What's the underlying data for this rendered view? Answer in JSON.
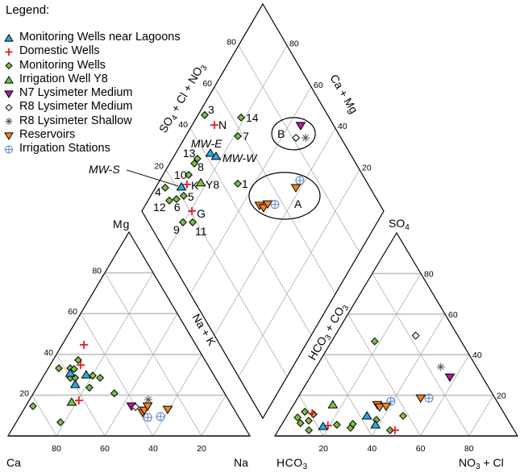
{
  "chart_data": {
    "type": "scatter",
    "subtype": "piper-trilinear",
    "legend_title": "Legend:",
    "legend_placement": "top-left",
    "series_styles": {
      "mwl": {
        "name": "Monitoring Wells near Lagoons",
        "marker": "triangle-up",
        "fill": "#29abe2",
        "stroke": "#000000"
      },
      "dom": {
        "name": "Domestic Wells",
        "marker": "plus",
        "fill": "none",
        "stroke": "#e8131b"
      },
      "mw": {
        "name": "Monitoring Wells",
        "marker": "diamond",
        "fill": "#7ac143",
        "stroke": "#000000"
      },
      "y8": {
        "name": "Irrigation Well Y8",
        "marker": "triangle-up",
        "fill": "#7ac143",
        "stroke": "#000000"
      },
      "n7": {
        "name": "N7 Lysimeter Medium",
        "marker": "triangle-down",
        "fill": "#b5179e",
        "stroke": "#000000"
      },
      "r8m": {
        "name": "R8 Lysimeter Medium",
        "marker": "diamond",
        "fill": "#ffffff",
        "stroke": "#000000"
      },
      "r8s": {
        "name": "R8 Lysimeter Shallow",
        "marker": "asterisk",
        "fill": "none",
        "stroke": "#555555"
      },
      "res": {
        "name": "Reservoirs",
        "marker": "triangle-down",
        "fill": "#f7821b",
        "stroke": "#000000"
      },
      "irr": {
        "name": "Irrigation Stations",
        "marker": "circle-plus",
        "fill": "none",
        "stroke": "#5b7fc7"
      }
    },
    "legend_order": [
      "mwl",
      "dom",
      "mw",
      "y8",
      "n7",
      "r8m",
      "r8s",
      "res",
      "irr"
    ],
    "cation_triangle": {
      "vertices": {
        "left": "Ca",
        "right": "Na",
        "top": "Mg"
      },
      "edge_label": "Na + K",
      "base_ticks": [
        "80",
        "60",
        "40",
        "20"
      ],
      "side_ticks": [
        "20",
        "40",
        "60",
        "80"
      ],
      "points": [
        {
          "series": "dom",
          "mg": 44.7,
          "na": 9.0
        },
        {
          "series": "dom",
          "mg": 34.8,
          "na": 12.6
        },
        {
          "series": "dom",
          "mg": 17.4,
          "na": 20.6
        },
        {
          "series": "mw",
          "mg": 37.2,
          "na": 10.4
        },
        {
          "series": "mw",
          "mg": 33.2,
          "na": 4.4
        },
        {
          "series": "mw",
          "mg": 33.2,
          "na": 9.1
        },
        {
          "series": "mw",
          "mg": 32.8,
          "na": 10.9
        },
        {
          "series": "mw",
          "mg": 28.5,
          "na": 11.5
        },
        {
          "series": "mw",
          "mg": 28.5,
          "na": 13.5
        },
        {
          "series": "mw",
          "mg": 29.6,
          "na": 20.2
        },
        {
          "series": "mw",
          "mg": 28.5,
          "na": 23.8
        },
        {
          "series": "mw",
          "mg": 23.7,
          "na": 21.8
        },
        {
          "series": "mw",
          "mg": 20.9,
          "na": 33.5
        },
        {
          "series": "mw",
          "mg": 14.6,
          "na": 3.0
        },
        {
          "series": "mw",
          "mg": 6.7,
          "na": 18.3
        },
        {
          "series": "mwl",
          "mg": 30.8,
          "na": 10.3
        },
        {
          "series": "mwl",
          "mg": 30.0,
          "na": 17.3
        },
        {
          "series": "mwl",
          "mg": 25.3,
          "na": 15.1
        },
        {
          "series": "y8",
          "mg": 16.6,
          "na": 18.0
        },
        {
          "series": "n7",
          "mg": 14.6,
          "na": 43.7
        },
        {
          "series": "r8m",
          "mg": 14.2,
          "na": 45.6
        },
        {
          "series": "r8s",
          "mg": 17.8,
          "na": 49.1
        },
        {
          "series": "res",
          "mg": 11.5,
          "na": 50.0
        },
        {
          "series": "res",
          "mg": 12.6,
          "na": 50.0
        },
        {
          "series": "res",
          "mg": 14.6,
          "na": 50.4
        },
        {
          "series": "res",
          "mg": 13.0,
          "na": 59.5
        },
        {
          "series": "irr",
          "mg": 9.1,
          "na": 53.2
        },
        {
          "series": "irr",
          "mg": 9.5,
          "na": 58.3
        }
      ]
    },
    "anion_triangle": {
      "vertices": {
        "left": "HCO3",
        "right": "NO3 + Cl",
        "top": "SO4"
      },
      "edge_label": "HCO3 + CO3",
      "base_ticks": [
        "20",
        "40",
        "60",
        "80"
      ],
      "side_ticks": [
        "20",
        "40",
        "60",
        "80"
      ],
      "points": [
        {
          "series": "mw",
          "so4": 46.6,
          "cl": 17.9
        },
        {
          "series": "mw",
          "so4": 9.1,
          "cl": 4.8
        },
        {
          "series": "mw",
          "so4": 6.3,
          "cl": 7.4
        },
        {
          "series": "mw",
          "so4": 11.9,
          "cl": 6.4
        },
        {
          "series": "mw",
          "so4": 7.5,
          "cl": 10.2
        },
        {
          "series": "mw",
          "so4": 2.8,
          "cl": 12.6
        },
        {
          "series": "mw",
          "so4": 10.7,
          "cl": 10.6
        },
        {
          "series": "mw",
          "so4": 5.5,
          "cl": 22.8
        },
        {
          "series": "mw",
          "so4": 4.0,
          "cl": 29.2
        },
        {
          "series": "mw",
          "so4": 5.9,
          "cl": 29.2
        },
        {
          "series": "mw",
          "so4": 7.9,
          "cl": 37.9
        },
        {
          "series": "mw",
          "so4": 2.8,
          "cl": 46.1
        },
        {
          "series": "mw",
          "so4": 9.9,
          "cl": 47.9
        },
        {
          "series": "dom",
          "so4": 11.1,
          "cl": 9.8
        },
        {
          "series": "dom",
          "so4": 5.1,
          "cl": 19.3
        },
        {
          "series": "dom",
          "so4": 2.8,
          "cl": 48.1
        },
        {
          "series": "mwl",
          "so4": 4.7,
          "cl": 17.5
        },
        {
          "series": "mwl",
          "so4": 9.9,
          "cl": 33.0
        },
        {
          "series": "mwl",
          "so4": 5.5,
          "cl": 38.7
        },
        {
          "series": "y8",
          "so4": 15.4,
          "cl": 16.2
        },
        {
          "series": "res",
          "so4": 15.4,
          "cl": 34.5
        },
        {
          "series": "res",
          "so4": 14.2,
          "cl": 36.1
        },
        {
          "series": "res",
          "so4": 14.6,
          "cl": 38.5
        },
        {
          "series": "res",
          "so4": 18.6,
          "cl": 50.8
        },
        {
          "series": "irr",
          "so4": 17.0,
          "cl": 39.3
        },
        {
          "series": "irr",
          "so4": 18.6,
          "cl": 54.2
        },
        {
          "series": "r8m",
          "so4": 49.4,
          "cl": 33.4
        },
        {
          "series": "r8s",
          "so4": 34.0,
          "cl": 51.4
        },
        {
          "series": "n7",
          "so4": 28.9,
          "cl": 57.7
        }
      ]
    },
    "diamond": {
      "left_edge_label": "SO4 + Cl + NO3",
      "right_edge_label": "Ca + Mg",
      "left_ticks": [
        "20",
        "40",
        "60",
        "80"
      ],
      "right_ticks": [
        "80",
        "60",
        "40",
        "20"
      ],
      "points": [
        {
          "series": "mw",
          "s": 49.2,
          "c": 97.2,
          "label": "3"
        },
        {
          "series": "dom",
          "s": 50.8,
          "c": 90.8,
          "label": "N"
        },
        {
          "series": "mw",
          "s": 63.6,
          "c": 81.6,
          "label": "14"
        },
        {
          "series": "mw",
          "s": 57.8,
          "c": 78.4,
          "label": "7"
        },
        {
          "series": "mwl",
          "s": 42.3,
          "c": 85.7,
          "label": "MW-E",
          "italic": true
        },
        {
          "series": "mwl",
          "s": 43.9,
          "c": 82.6,
          "label": "MW-W",
          "italic": true
        },
        {
          "series": "mw",
          "s": 35.6,
          "c": 89.7,
          "label": "13"
        },
        {
          "series": "mw",
          "s": 33.2,
          "c": 89.8,
          "label": "8"
        },
        {
          "series": "mw",
          "s": 28.1,
          "c": 89.4,
          "label": "10"
        },
        {
          "series": "mw",
          "s": 46.3,
          "c": 67.0,
          "label": "1"
        },
        {
          "series": "mwl",
          "s": 22.2,
          "c": 89.5,
          "label": "MW-S",
          "italic": true
        },
        {
          "series": "dom",
          "s": 25.1,
          "c": 87.8,
          "label": "K"
        },
        {
          "series": "y8",
          "s": 31.2,
          "c": 82.5,
          "label": "Y8"
        },
        {
          "series": "mw",
          "s": 15.3,
          "c": 96.0,
          "label": "4"
        },
        {
          "series": "mw",
          "s": 21.0,
          "c": 86.4,
          "label": "5"
        },
        {
          "series": "mw",
          "s": 17.2,
          "c": 88.6,
          "label": "6"
        },
        {
          "series": "mw",
          "s": 13.9,
          "c": 91.2,
          "label": "12"
        },
        {
          "series": "dom",
          "s": 20.7,
          "c": 79.3,
          "label": "G"
        },
        {
          "series": "mw",
          "s": 14.3,
          "c": 80.3,
          "label": "9"
        },
        {
          "series": "mw",
          "s": 18.3,
          "c": 76.3,
          "label": "11"
        },
        {
          "series": "n7",
          "s": 86.3,
          "c": 55.0,
          "label": ""
        },
        {
          "series": "r8m",
          "s": 81.4,
          "c": 54.0,
          "label": ""
        },
        {
          "series": "r8s",
          "s": 85.4,
          "c": 50.0,
          "label": ""
        },
        {
          "series": "irr",
          "s": 72.7,
          "c": 42.1,
          "label": ""
        },
        {
          "series": "res",
          "s": 69.3,
          "c": 42.0,
          "label": ""
        },
        {
          "series": "res",
          "s": 50.0,
          "c": 52.7,
          "label": ""
        },
        {
          "series": "res",
          "s": 51.1,
          "c": 50.5,
          "label": ""
        },
        {
          "series": "res",
          "s": 53.7,
          "c": 49.7,
          "label": ""
        },
        {
          "series": "irr",
          "s": 56.6,
          "c": 46.6,
          "label": ""
        }
      ],
      "groups": [
        {
          "label": "A",
          "s": 62.7,
          "c": 44.7
        },
        {
          "label": "B",
          "s": 81.4,
          "c": 56.0
        }
      ]
    }
  }
}
